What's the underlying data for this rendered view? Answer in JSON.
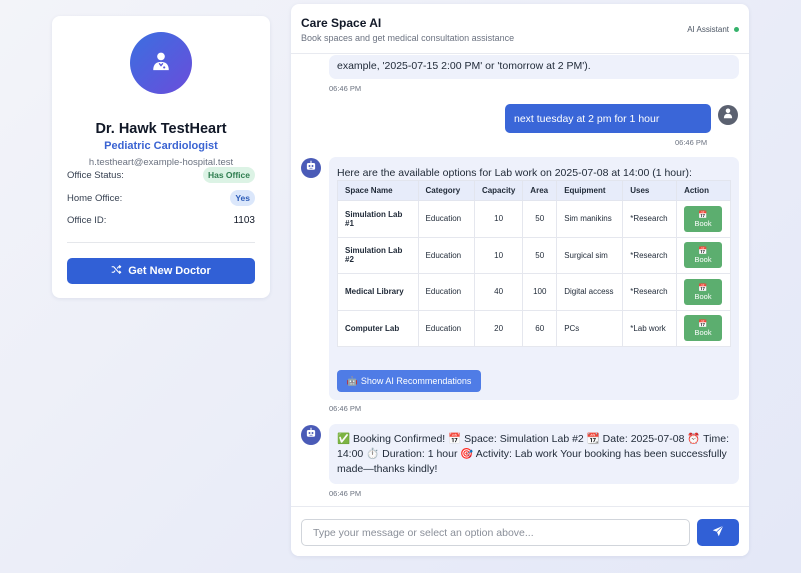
{
  "profile": {
    "name": "Dr. Hawk TestHeart",
    "specialty": "Pediatric Cardiologist",
    "email": "h.testheart@example-hospital.test",
    "office_status_label": "Office Status:",
    "office_status_value": "Has Office",
    "home_office_label": "Home Office:",
    "home_office_value": "Yes",
    "office_id_label": "Office ID:",
    "office_id_value": "1103",
    "new_doctor_button": "Get New Doctor"
  },
  "chat": {
    "title": "Care Space AI",
    "subtitle": "Book spaces and get medical consultation assistance",
    "assistant_label": "AI Assistant",
    "prev_bot_text": "example, '2025-07-15 2:00 PM' or 'tomorrow at 2 PM').",
    "prev_bot_time": "06:46 PM",
    "user_message": "next tuesday at 2 pm for 1 hour",
    "user_time": "06:46 PM",
    "options_intro": "Here are the available options for Lab work on 2025-07-08 at 14:00 (1 hour):",
    "table_headers": [
      "Space Name",
      "Category",
      "Capacity",
      "Area",
      "Equipment",
      "Uses",
      "Action"
    ],
    "table_rows": [
      {
        "name": "Simulation Lab #1",
        "category": "Education",
        "capacity": "10",
        "area": "50",
        "equipment": "Sim manikins",
        "uses": "*Research"
      },
      {
        "name": "Simulation Lab #2",
        "category": "Education",
        "capacity": "10",
        "area": "50",
        "equipment": "Surgical sim",
        "uses": "*Research"
      },
      {
        "name": "Medical Library",
        "category": "Education",
        "capacity": "40",
        "area": "100",
        "equipment": "Digital access",
        "uses": "*Research"
      },
      {
        "name": "Computer Lab",
        "category": "Education",
        "capacity": "20",
        "area": "60",
        "equipment": "PCs",
        "uses": "*Lab work"
      }
    ],
    "book_icon": "📅",
    "book_label": "Book",
    "ai_rec_icon": "🤖",
    "ai_rec_button": "Show AI Recommendations",
    "options_time": "06:46 PM",
    "confirmation_text": "✅ Booking Confirmed! 📅 Space: Simulation Lab #2 📆 Date: 2025-07-08 ⏰ Time: 14:00 ⏱️ Duration: 1 hour 🎯 Activity: Lab work Your booking has been successfully made—thanks kindly!",
    "confirmation_time": "06:46 PM",
    "input_placeholder": "Type your message or select an option above..."
  },
  "colors": {
    "primary": "#3160d6",
    "book_green": "#5cae6f",
    "status_green": "#35b26b"
  },
  "icons": {
    "avatar": "doctor-icon",
    "new_doctor": "shuffle-icon",
    "bot": "robot-icon",
    "user": "user-icon",
    "send": "paper-plane-icon"
  }
}
